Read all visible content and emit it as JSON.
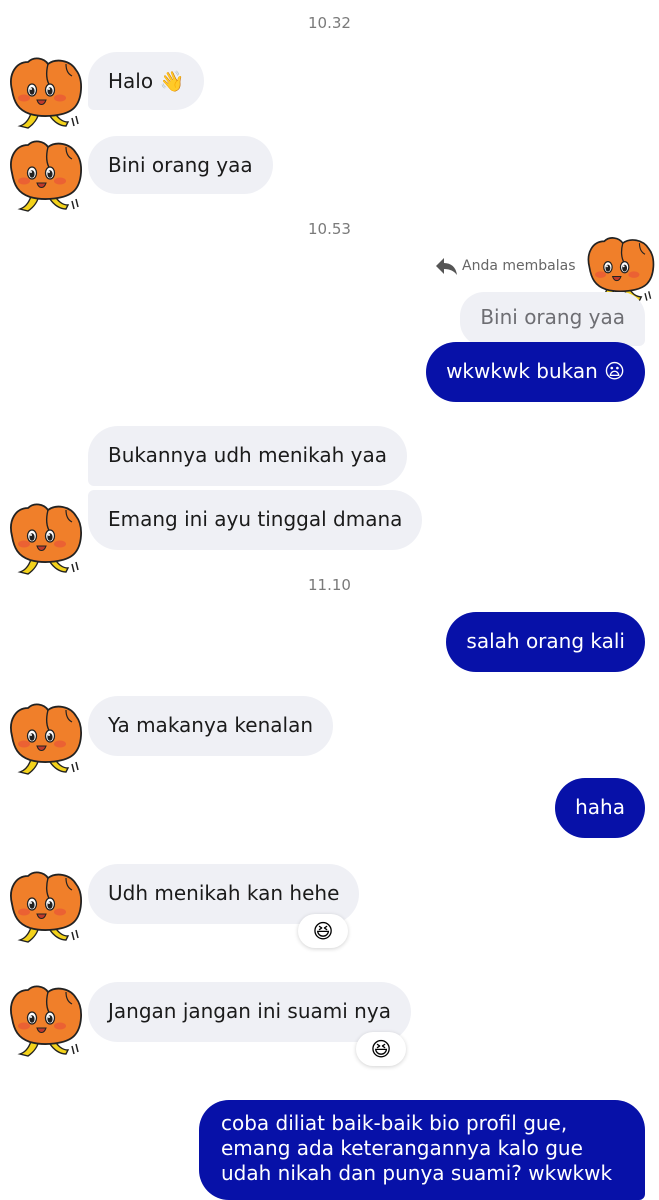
{
  "timestamps": {
    "t1": "10.32",
    "t2": "10.53",
    "t3": "11.10"
  },
  "messages": {
    "m1": "Halo 👋",
    "m2": "Bini orang yaa",
    "reply_label": "Anda membalas",
    "quoted": "Bini orang yaa",
    "m3": "wkwkwk bukan 😦",
    "m4": "Bukannya udh menikah yaa",
    "m5": "Emang ini ayu tinggal dmana",
    "m6": "salah orang kali",
    "m7": "Ya makanya kenalan",
    "m8": "haha",
    "m9": "Udh menikah kan hehe",
    "m10": "Jangan jangan ini suami nya",
    "m11": "coba diliat baik-baik bio profil gue, emang ada keterangannya kalo gue udah nikah dan punya suami? wkwkwk"
  },
  "reactions": {
    "r1": "😆",
    "r2": "😆"
  },
  "colors": {
    "incoming_bg": "#eff0f5",
    "outgoing_bg": "#0711a8",
    "avatar_orange": "#f07f2a",
    "avatar_feet": "#f3d21b"
  },
  "icons": {
    "reply": "reply-arrow-icon",
    "avatar": "orange-blob-sticker-avatar"
  }
}
